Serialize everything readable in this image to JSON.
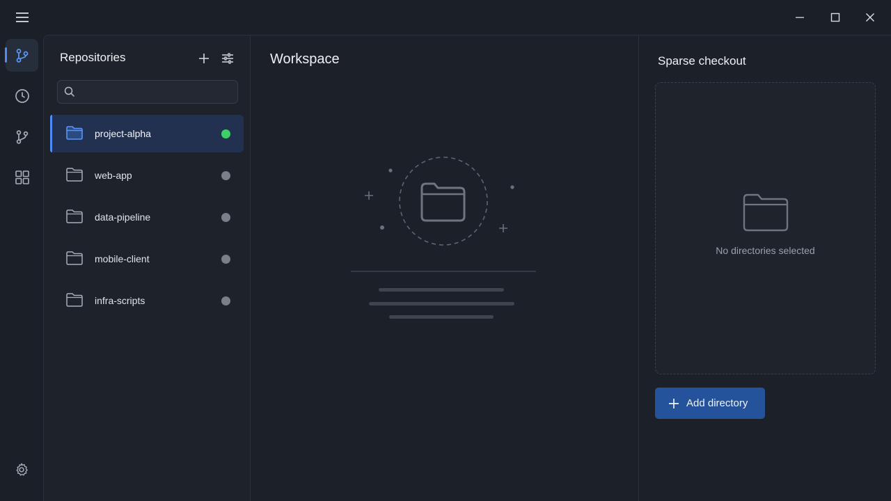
{
  "titlebar": {
    "menu_icon": "hamburger-icon",
    "controls": {
      "minimize_icon": "minimize-icon",
      "maximize_icon": "maximize-icon",
      "close_icon": "close-icon"
    }
  },
  "rail": {
    "items": [
      {
        "icon": "repository-icon",
        "active": true
      },
      {
        "icon": "history-icon",
        "active": false
      },
      {
        "icon": "branch-icon",
        "active": false
      },
      {
        "icon": "extensions-icon",
        "active": false
      }
    ],
    "settings_icon": "settings-icon"
  },
  "sidebar": {
    "title": "Repositories",
    "add_icon": "plus-icon",
    "filter_icon": "filter-icon",
    "search": {
      "placeholder": "",
      "value": "",
      "icon": "search-icon"
    },
    "repositories": [
      {
        "name": "project-alpha",
        "status": "online",
        "active": true
      },
      {
        "name": "web-app",
        "status": "offline",
        "active": false
      },
      {
        "name": "data-pipeline",
        "status": "offline",
        "active": false
      },
      {
        "name": "mobile-client",
        "status": "offline",
        "active": false
      },
      {
        "name": "infra-scripts",
        "status": "offline",
        "active": false
      }
    ],
    "colors": {
      "online": "#3fcf67",
      "offline": "#7a7f88",
      "accent": "#4f8cf6"
    }
  },
  "workspace": {
    "title": "Workspace",
    "empty_illustration_icon": "folder-icon"
  },
  "sparse_checkout": {
    "title": "Sparse checkout",
    "empty_text": "No directories selected",
    "empty_icon": "folder-icon",
    "add_button_label": "Add directory",
    "add_button_color": "#24539b"
  }
}
